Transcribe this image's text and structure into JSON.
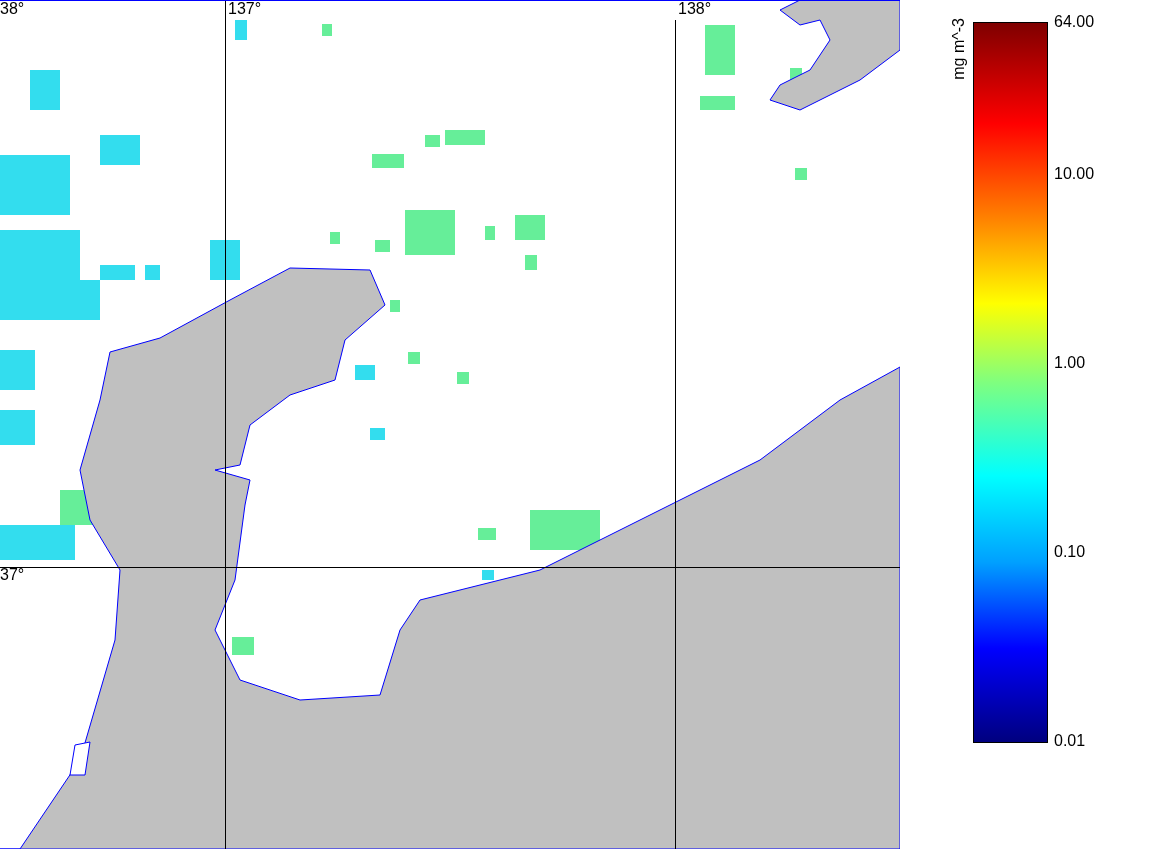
{
  "map": {
    "lon_labels": [
      "137°",
      "138°"
    ],
    "lat_labels": [
      "38°",
      "37°"
    ]
  },
  "colorbar": {
    "unit": "mg m^-3",
    "ticks": [
      "64.00",
      "10.00",
      "1.00",
      "0.10",
      "0.01"
    ]
  }
}
